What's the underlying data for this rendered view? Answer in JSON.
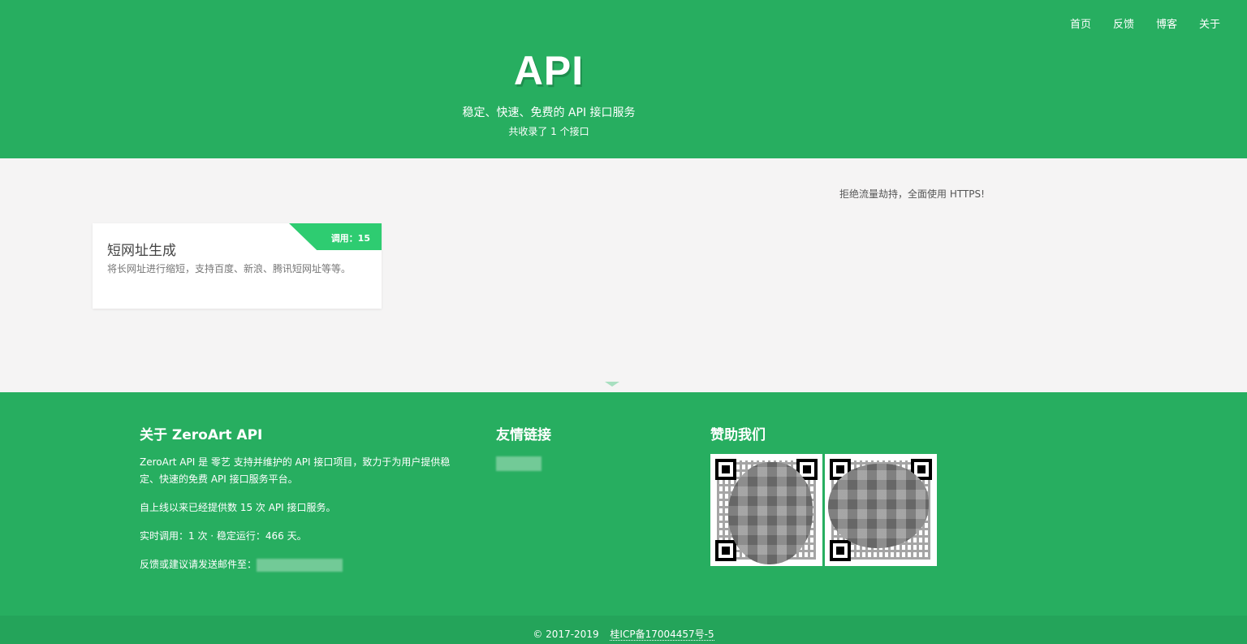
{
  "nav": {
    "items": [
      {
        "label": "首页"
      },
      {
        "label": "反馈"
      },
      {
        "label": "博客"
      },
      {
        "label": "关于"
      }
    ]
  },
  "header": {
    "title": "API",
    "subtitle": "稳定、快速、免费的 API 接口服务",
    "count": "共收录了 1 个接口"
  },
  "main": {
    "notice": "拒绝流量劫持，全面使用 HTTPS!",
    "cards": [
      {
        "badge": "调用：15",
        "title": "短网址生成",
        "description": "将长网址进行缩短，支持百度、新浪、腾讯短网址等等。"
      }
    ]
  },
  "footer": {
    "about": {
      "title": "关于 ZeroArt API",
      "p1": "ZeroArt API 是 零艺 支持并维护的 API 接口项目，致力于为用户提供稳定、快速的免费 API 接口服务平台。",
      "p2": "自上线以来已经提供数 15 次 API 接口服务。",
      "p3": "实时调用：1 次 · 稳定运行：466 天。",
      "p4": "反馈或建议请发送邮件至："
    },
    "links": {
      "title": "友情链接"
    },
    "sponsor": {
      "title": "赞助我们"
    }
  },
  "copyright": {
    "text": "© 2017-2019",
    "icp": "桂ICP备17004457号-5"
  },
  "colors": {
    "brand_green": "#27ae60",
    "badge_green": "#2ecc71",
    "background": "#f5f4f4"
  }
}
